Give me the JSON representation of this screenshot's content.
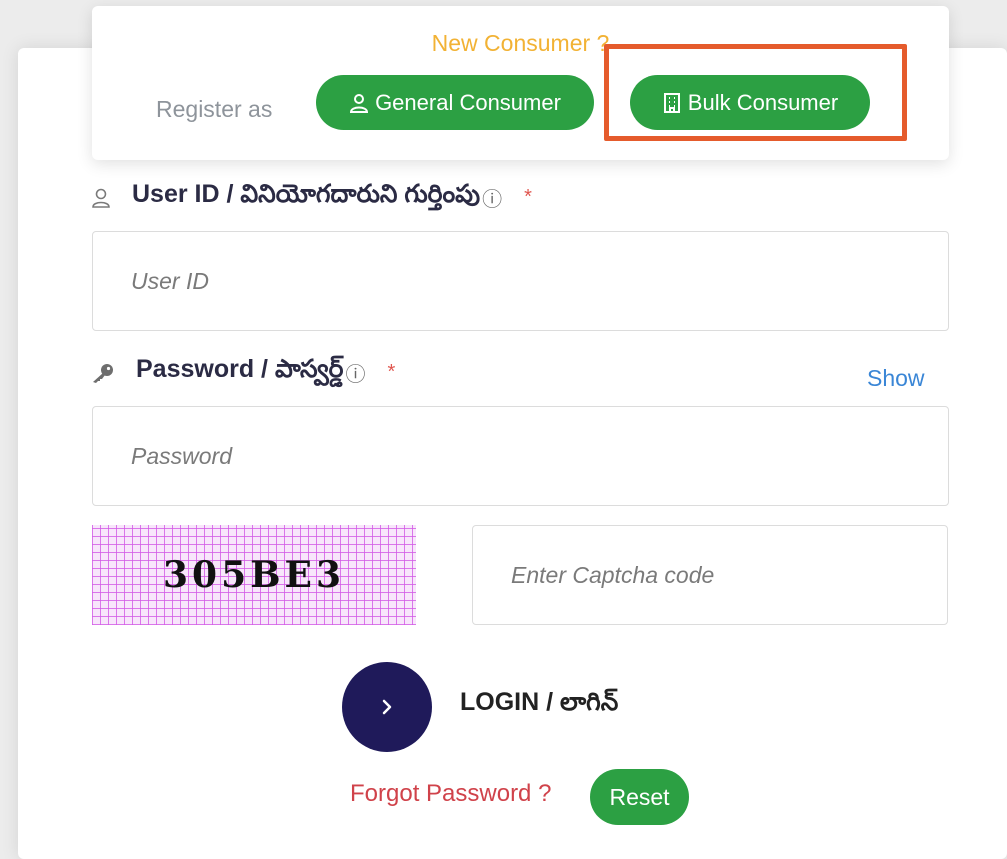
{
  "register": {
    "heading": "New Consumer ?",
    "label": "Register as",
    "general_button": "General Consumer",
    "bulk_button": "Bulk Consumer"
  },
  "user_field": {
    "label": "User ID / వినియోగదారుని గుర్తింపు",
    "info_icon": "ⓘ",
    "required": "*",
    "placeholder": "User ID",
    "value": ""
  },
  "password_field": {
    "label": "Password / పాస్వర్డ్",
    "info_icon": "ⓘ",
    "required": "*",
    "placeholder": "Password",
    "value": "",
    "show_label": "Show"
  },
  "captcha": {
    "code": "305BE3",
    "placeholder": "Enter Captcha code",
    "value": ""
  },
  "login": {
    "label": "LOGIN / లాగిన్"
  },
  "forgot": {
    "text": "Forgot Password ?",
    "reset_label": "Reset"
  },
  "colors": {
    "green": "#2ca043",
    "highlight": "#e55b2c",
    "navy": "#1f1a5a",
    "orange_text": "#f2b234",
    "red_text": "#d0424a",
    "link_blue": "#3a86d6"
  },
  "icons": {
    "general_button": "user-icon",
    "bulk_button": "building-icon",
    "user_label": "user-icon",
    "password_label": "key-icon",
    "login": "chevron-right-icon"
  }
}
